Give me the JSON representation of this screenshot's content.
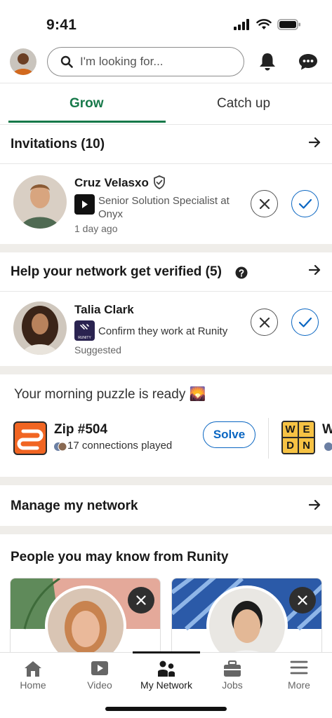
{
  "status": {
    "time": "9:41"
  },
  "search": {
    "placeholder": "I'm looking for..."
  },
  "tabs": [
    {
      "label": "Grow"
    },
    {
      "label": "Catch up"
    }
  ],
  "invitations": {
    "title": "Invitations (10)",
    "items": [
      {
        "name": "Cruz Velasxo",
        "line1": "Senior Solution Specialist at",
        "line2": "Onyx",
        "meta": "1 day ago"
      }
    ]
  },
  "verify": {
    "title": "Help your network get verified (5)",
    "items": [
      {
        "name": "Talia Clark",
        "line1": "Confirm they work at Runity",
        "meta": "Suggested",
        "logo_text": "RUNITY"
      }
    ]
  },
  "puzzle": {
    "title": "Your morning puzzle is ready 🌄",
    "zip_title": "Zip #504",
    "zip_sub": "17 connections played",
    "solve_label": "Solve",
    "next_letters": [
      "W",
      "E",
      "D",
      "N"
    ],
    "next_title_partial": "W"
  },
  "manage": {
    "title": "Manage my network"
  },
  "pymk": {
    "title": "People you may know from Runity"
  },
  "nav": [
    {
      "label": "Home",
      "icon": "home-icon"
    },
    {
      "label": "Video",
      "icon": "video-icon"
    },
    {
      "label": "My Network",
      "icon": "network-icon",
      "active": true
    },
    {
      "label": "Jobs",
      "icon": "briefcase-icon"
    },
    {
      "label": "More",
      "icon": "menu-icon"
    }
  ],
  "colors": {
    "accent_green": "#17794a",
    "accent_blue": "#0a66c2",
    "zip_orange": "#f16522",
    "wend_yellow": "#f6c244"
  }
}
